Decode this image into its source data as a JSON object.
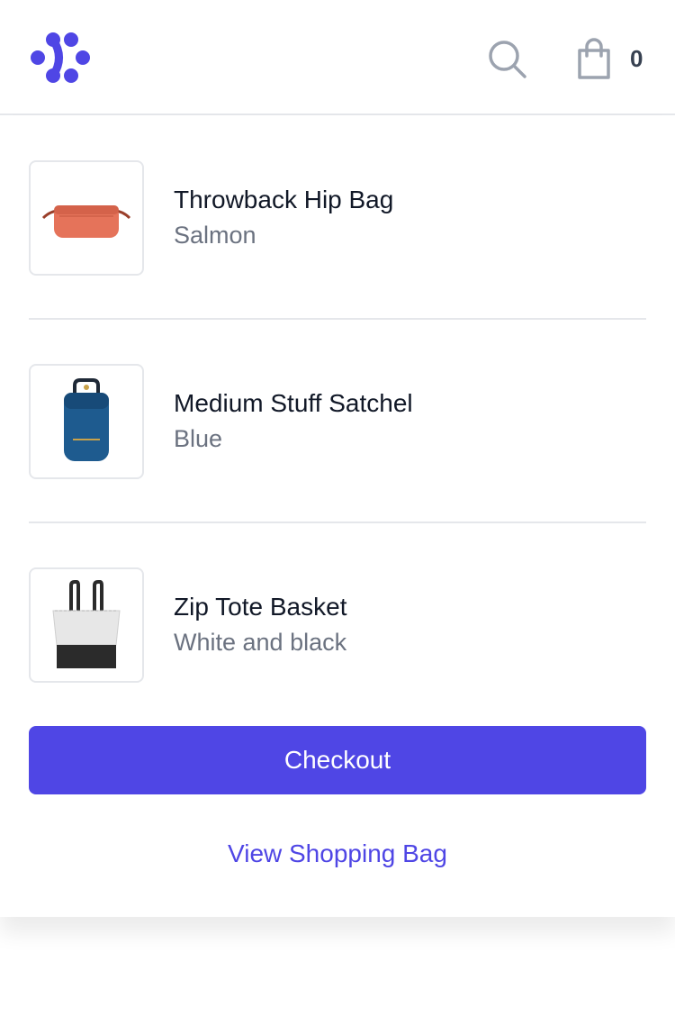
{
  "header": {
    "logo_icon": "brand-dots-icon",
    "brand_color": "#4f46e5",
    "search_icon": "search-icon",
    "cart_icon": "shopping-bag-icon",
    "cart_count": "0"
  },
  "cart": {
    "items": [
      {
        "name": "Throwback Hip Bag",
        "color": "Salmon",
        "image_icon": "hip-bag-image"
      },
      {
        "name": "Medium Stuff Satchel",
        "color": "Blue",
        "image_icon": "satchel-image"
      },
      {
        "name": "Zip Tote Basket",
        "color": "White and black",
        "image_icon": "tote-basket-image"
      }
    ],
    "checkout_label": "Checkout",
    "view_bag_label": "View Shopping Bag"
  },
  "colors": {
    "accent": "#4f46e5",
    "text_primary": "#111827",
    "text_secondary": "#6b7280",
    "border": "#e5e7eb"
  }
}
